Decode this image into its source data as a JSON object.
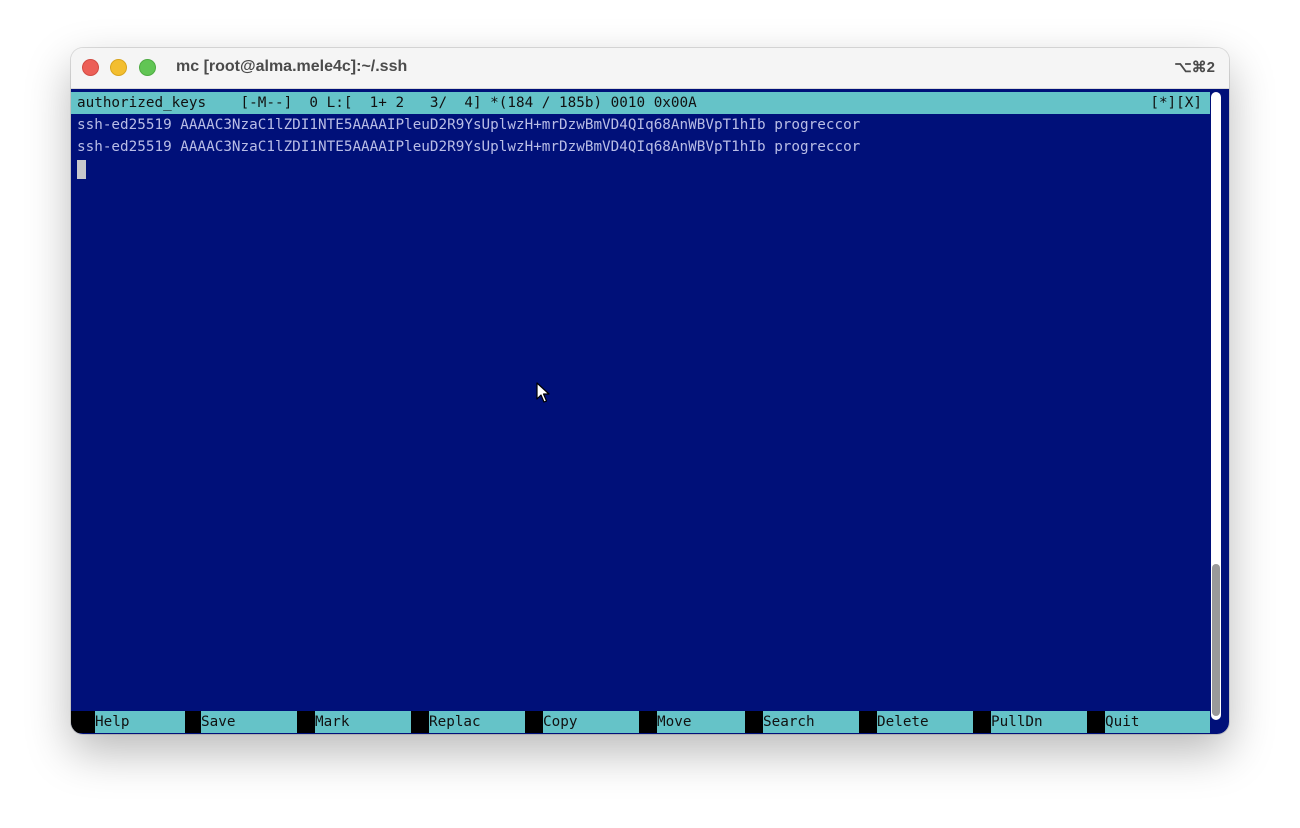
{
  "window": {
    "title": "mc [root@alma.mele4c]:~/.ssh",
    "shortcut": "⌥⌘2"
  },
  "editor": {
    "status_left": "authorized_keys    [-M--]  0 L:[  1+ 2   3/  4] *(184 / 185b) 0010 0x00A",
    "status_right": "[*][X]",
    "lines": [
      "ssh-ed25519 AAAAC3NzaC1lZDI1NTE5AAAAIPleuD2R9YsUplwzH+mrDzwBmVD4QIq68AnWBVpT1hIb progreccor",
      "ssh-ed25519 AAAAC3NzaC1lZDI1NTE5AAAAIPleuD2R9YsUplwzH+mrDzwBmVD4QIq68AnWBVpT1hIb progreccor"
    ]
  },
  "fkeys": [
    {
      "num": "1",
      "label": "Help"
    },
    {
      "num": "2",
      "label": "Save"
    },
    {
      "num": "3",
      "label": "Mark"
    },
    {
      "num": "4",
      "label": "Replac"
    },
    {
      "num": "5",
      "label": "Copy"
    },
    {
      "num": "6",
      "label": "Move"
    },
    {
      "num": "7",
      "label": "Search"
    },
    {
      "num": "8",
      "label": "Delete"
    },
    {
      "num": "9",
      "label": "PullDn"
    },
    {
      "num": "10",
      "label": "Quit"
    }
  ],
  "colors": {
    "terminal_bg": "#001079",
    "bar_cyan": "#65c3c8"
  }
}
